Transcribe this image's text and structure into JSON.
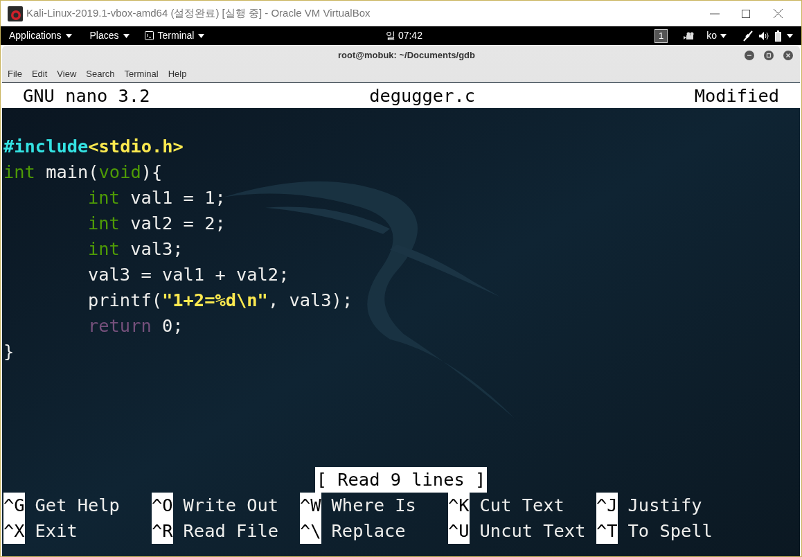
{
  "host_window": {
    "title": "Kali-Linux-2019.1-vbox-amd64 (설정완료) [실행 중] - Oracle VM VirtualBox"
  },
  "top_panel": {
    "menus": [
      "Applications",
      "Places",
      "Terminal"
    ],
    "clock": "일 07:42",
    "workspace": "1",
    "language": "ko"
  },
  "terminal": {
    "title": "root@mobuk: ~/Documents/gdb",
    "menu": [
      "File",
      "Edit",
      "View",
      "Search",
      "Terminal",
      "Help"
    ]
  },
  "nano": {
    "version": "GNU nano 3.2",
    "filename": "degugger.c",
    "state": "Modified",
    "lines": [
      {
        "indented": false,
        "segments": [
          {
            "kind": "preproc",
            "text": "#include"
          },
          {
            "kind": "header",
            "text": "<stdio.h>"
          }
        ]
      },
      {
        "indented": false,
        "segments": [
          {
            "kind": "type",
            "text": "int"
          },
          {
            "kind": "plain",
            "text": " main("
          },
          {
            "kind": "type",
            "text": "void"
          },
          {
            "kind": "plain",
            "text": "){"
          }
        ]
      },
      {
        "indented": true,
        "segments": [
          {
            "kind": "type",
            "text": "int"
          },
          {
            "kind": "plain",
            "text": " val1 = 1;"
          }
        ]
      },
      {
        "indented": true,
        "segments": [
          {
            "kind": "type",
            "text": "int"
          },
          {
            "kind": "plain",
            "text": " val2 = 2;"
          }
        ]
      },
      {
        "indented": true,
        "segments": [
          {
            "kind": "type",
            "text": "int"
          },
          {
            "kind": "plain",
            "text": " val3;"
          }
        ]
      },
      {
        "indented": true,
        "segments": [
          {
            "kind": "plain",
            "text": "val3 = val1 + val2;"
          }
        ]
      },
      {
        "indented": true,
        "segments": [
          {
            "kind": "plain",
            "text": "printf("
          },
          {
            "kind": "string",
            "text": "\"1+2=%d\\n\""
          },
          {
            "kind": "plain",
            "text": ", val3);"
          }
        ]
      },
      {
        "indented": true,
        "segments": [
          {
            "kind": "keyword",
            "text": "return"
          },
          {
            "kind": "plain",
            "text": " 0;"
          }
        ]
      },
      {
        "indented": false,
        "segments": [
          {
            "kind": "plain",
            "text": "}"
          }
        ]
      }
    ],
    "status": "[ Read 9 lines ]",
    "shortcuts": [
      [
        {
          "key": "^G",
          "label": "Get Help"
        },
        {
          "key": "^O",
          "label": "Write Out"
        },
        {
          "key": "^W",
          "label": "Where Is"
        },
        {
          "key": "^K",
          "label": "Cut Text"
        },
        {
          "key": "^J",
          "label": "Justify"
        }
      ],
      [
        {
          "key": "^X",
          "label": "Exit"
        },
        {
          "key": "^R",
          "label": "Read File"
        },
        {
          "key": "^\\",
          "label": "Replace"
        },
        {
          "key": "^U",
          "label": "Uncut Text"
        },
        {
          "key": "^T",
          "label": "To Spell"
        }
      ]
    ]
  }
}
